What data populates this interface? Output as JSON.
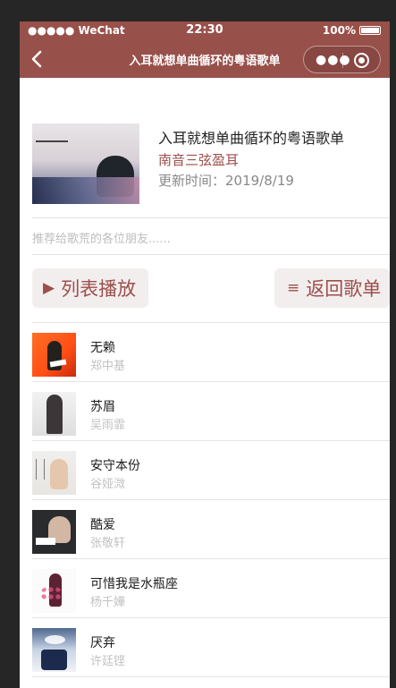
{
  "status_bar": {
    "carrier": "●●●●● WeChat",
    "time": "22:30",
    "battery_text": "100%"
  },
  "nav": {
    "title": "入耳就想单曲循环的粤语歌单"
  },
  "playlist": {
    "title": "入耳就想单曲循环的粤语歌单",
    "author": "南音三弦盈耳",
    "updated": "更新时间：2019/8/19",
    "recommend_placeholder": "推荐给歌荒的各位朋友......"
  },
  "actions": {
    "play_label": "列表播放",
    "back_label": "返回歌单"
  },
  "songs": [
    {
      "name": "无赖",
      "artist": "郑中基"
    },
    {
      "name": "苏眉",
      "artist": "吴雨霏"
    },
    {
      "name": "安守本份",
      "artist": "谷娅溦"
    },
    {
      "name": "酷爱",
      "artist": "张敬轩"
    },
    {
      "name": "可惜我是水瓶座",
      "artist": "杨千嬅"
    },
    {
      "name": "厌弃",
      "artist": "许廷铿"
    }
  ],
  "colors": {
    "nav_background": "#98504a",
    "accent": "#9b4f4b",
    "button_background": "#f3eeee"
  },
  "icons": {
    "back": "chevron-left-icon",
    "more": "more-dots-icon",
    "close": "target-circle-icon",
    "play": "play-triangle-icon",
    "menu": "menu-lines-icon"
  }
}
